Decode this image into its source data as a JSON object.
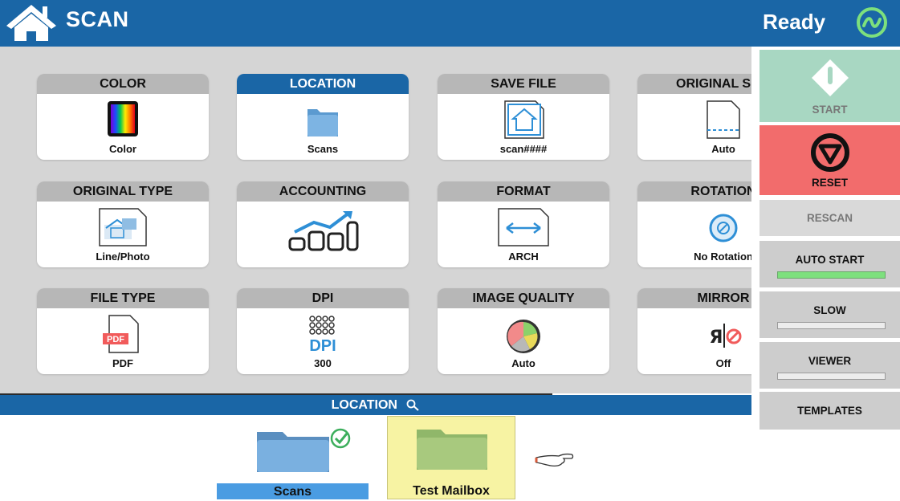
{
  "header": {
    "title": "SCAN",
    "status": "Ready"
  },
  "tiles": [
    {
      "header": "COLOR",
      "value": "Color",
      "icon": "color-spectrum-icon"
    },
    {
      "header": "LOCATION",
      "value": "Scans",
      "icon": "folder-icon",
      "active": true
    },
    {
      "header": "SAVE FILE",
      "value": "scan####",
      "icon": "save-file-house-icon"
    },
    {
      "header": "ORIGINAL SIZE",
      "value": "Auto",
      "icon": "original-size-icon"
    },
    {
      "header": "ORIGINAL TYPE",
      "value": "Line/Photo",
      "icon": "line-photo-icon"
    },
    {
      "header": "ACCOUNTING",
      "value": "",
      "icon": "accounting-chart-icon"
    },
    {
      "header": "FORMAT",
      "value": "ARCH",
      "icon": "format-arrows-icon"
    },
    {
      "header": "ROTATION",
      "value": "No Rotation",
      "icon": "rotation-icon"
    },
    {
      "header": "FILE TYPE",
      "value": "PDF",
      "icon": "pdf-file-icon"
    },
    {
      "header": "DPI",
      "value": "300",
      "icon": "dpi-icon"
    },
    {
      "header": "IMAGE QUALITY",
      "value": "Auto",
      "icon": "image-quality-pie-icon"
    },
    {
      "header": "MIRROR",
      "value": "Off",
      "icon": "mirror-off-icon"
    }
  ],
  "side": {
    "start": "START",
    "reset": "RESET",
    "rescan": "RESCAN",
    "auto_start": "AUTO START",
    "slow": "SLOW",
    "viewer": "VIEWER",
    "templates": "TEMPLATES",
    "toggles": {
      "auto_start": true,
      "slow": false,
      "viewer": false
    }
  },
  "location_panel": {
    "title": "LOCATION",
    "folders": [
      {
        "label": "Scans",
        "selected": true
      },
      {
        "label": "Test Mailbox",
        "highlighted": true
      }
    ]
  },
  "colors": {
    "accent": "#1a66a6",
    "grid_bg": "#d5d5d5",
    "start_green": "#a8d7c2",
    "reset_red": "#f26c6c",
    "toggle_on": "#7de07d",
    "mailbox_highlight": "#f7f3a3"
  }
}
